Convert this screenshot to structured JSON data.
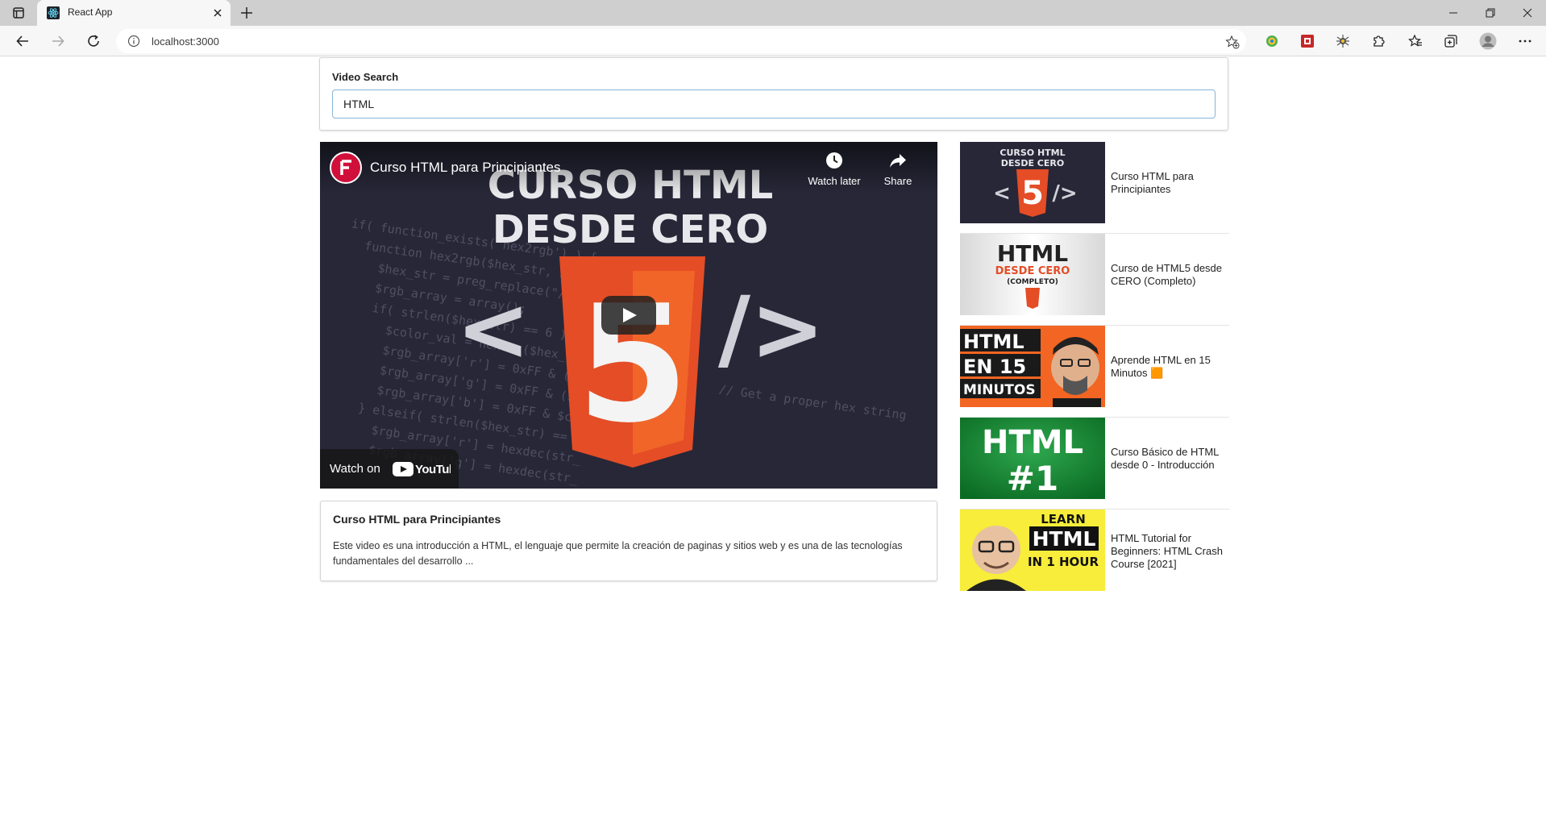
{
  "browser": {
    "tab_title": "React App",
    "url": "localhost:3000"
  },
  "search": {
    "label": "Video Search",
    "value": "HTML"
  },
  "player": {
    "overlay_title": "Curso HTML para Principiantes",
    "watch_later_label": "Watch later",
    "share_label": "Share",
    "watch_on_label": "Watch on",
    "brand_label": "YouTube",
    "thumbnail_text_line1": "CURSO HTML",
    "thumbnail_text_line2": "DESDE CERO",
    "thumbnail_bracket_left": "<",
    "thumbnail_bracket_right": "/>",
    "thumbnail_shield_glyph": "5"
  },
  "selected_video": {
    "title": "Curso HTML para Principiantes",
    "description": "Este video es una introducción a HTML, el lenguaje que permite la creación de paginas y sitios web y es una de las tecnologías fundamentales del desarrollo ..."
  },
  "video_list": [
    {
      "title": "Curso HTML para Principiantes",
      "thumb_text": [
        "CURSO HTML",
        "DESDE CERO",
        "</>"
      ]
    },
    {
      "title": "Curso de HTML5 desde CERO (Completo)",
      "thumb_text": [
        "HTML",
        "DESDE CERO",
        "(COMPLETO)"
      ]
    },
    {
      "title": "Aprende HTML en 15 Minutos 🟧",
      "thumb_text": [
        "HTML",
        "EN 15",
        "MINUTOS"
      ]
    },
    {
      "title": "Curso Básico de HTML desde 0 - Introducción",
      "thumb_text": [
        "HTML",
        "#1"
      ]
    },
    {
      "title": "HTML Tutorial for Beginners: HTML Crash Course [2021]",
      "thumb_text": [
        "LEARN",
        "HTML",
        "IN 1 HOUR"
      ]
    }
  ],
  "colors": {
    "accent_input_border": "#85b7d9",
    "html5_orange": "#e44d26",
    "youtube_red": "#ff0000"
  }
}
